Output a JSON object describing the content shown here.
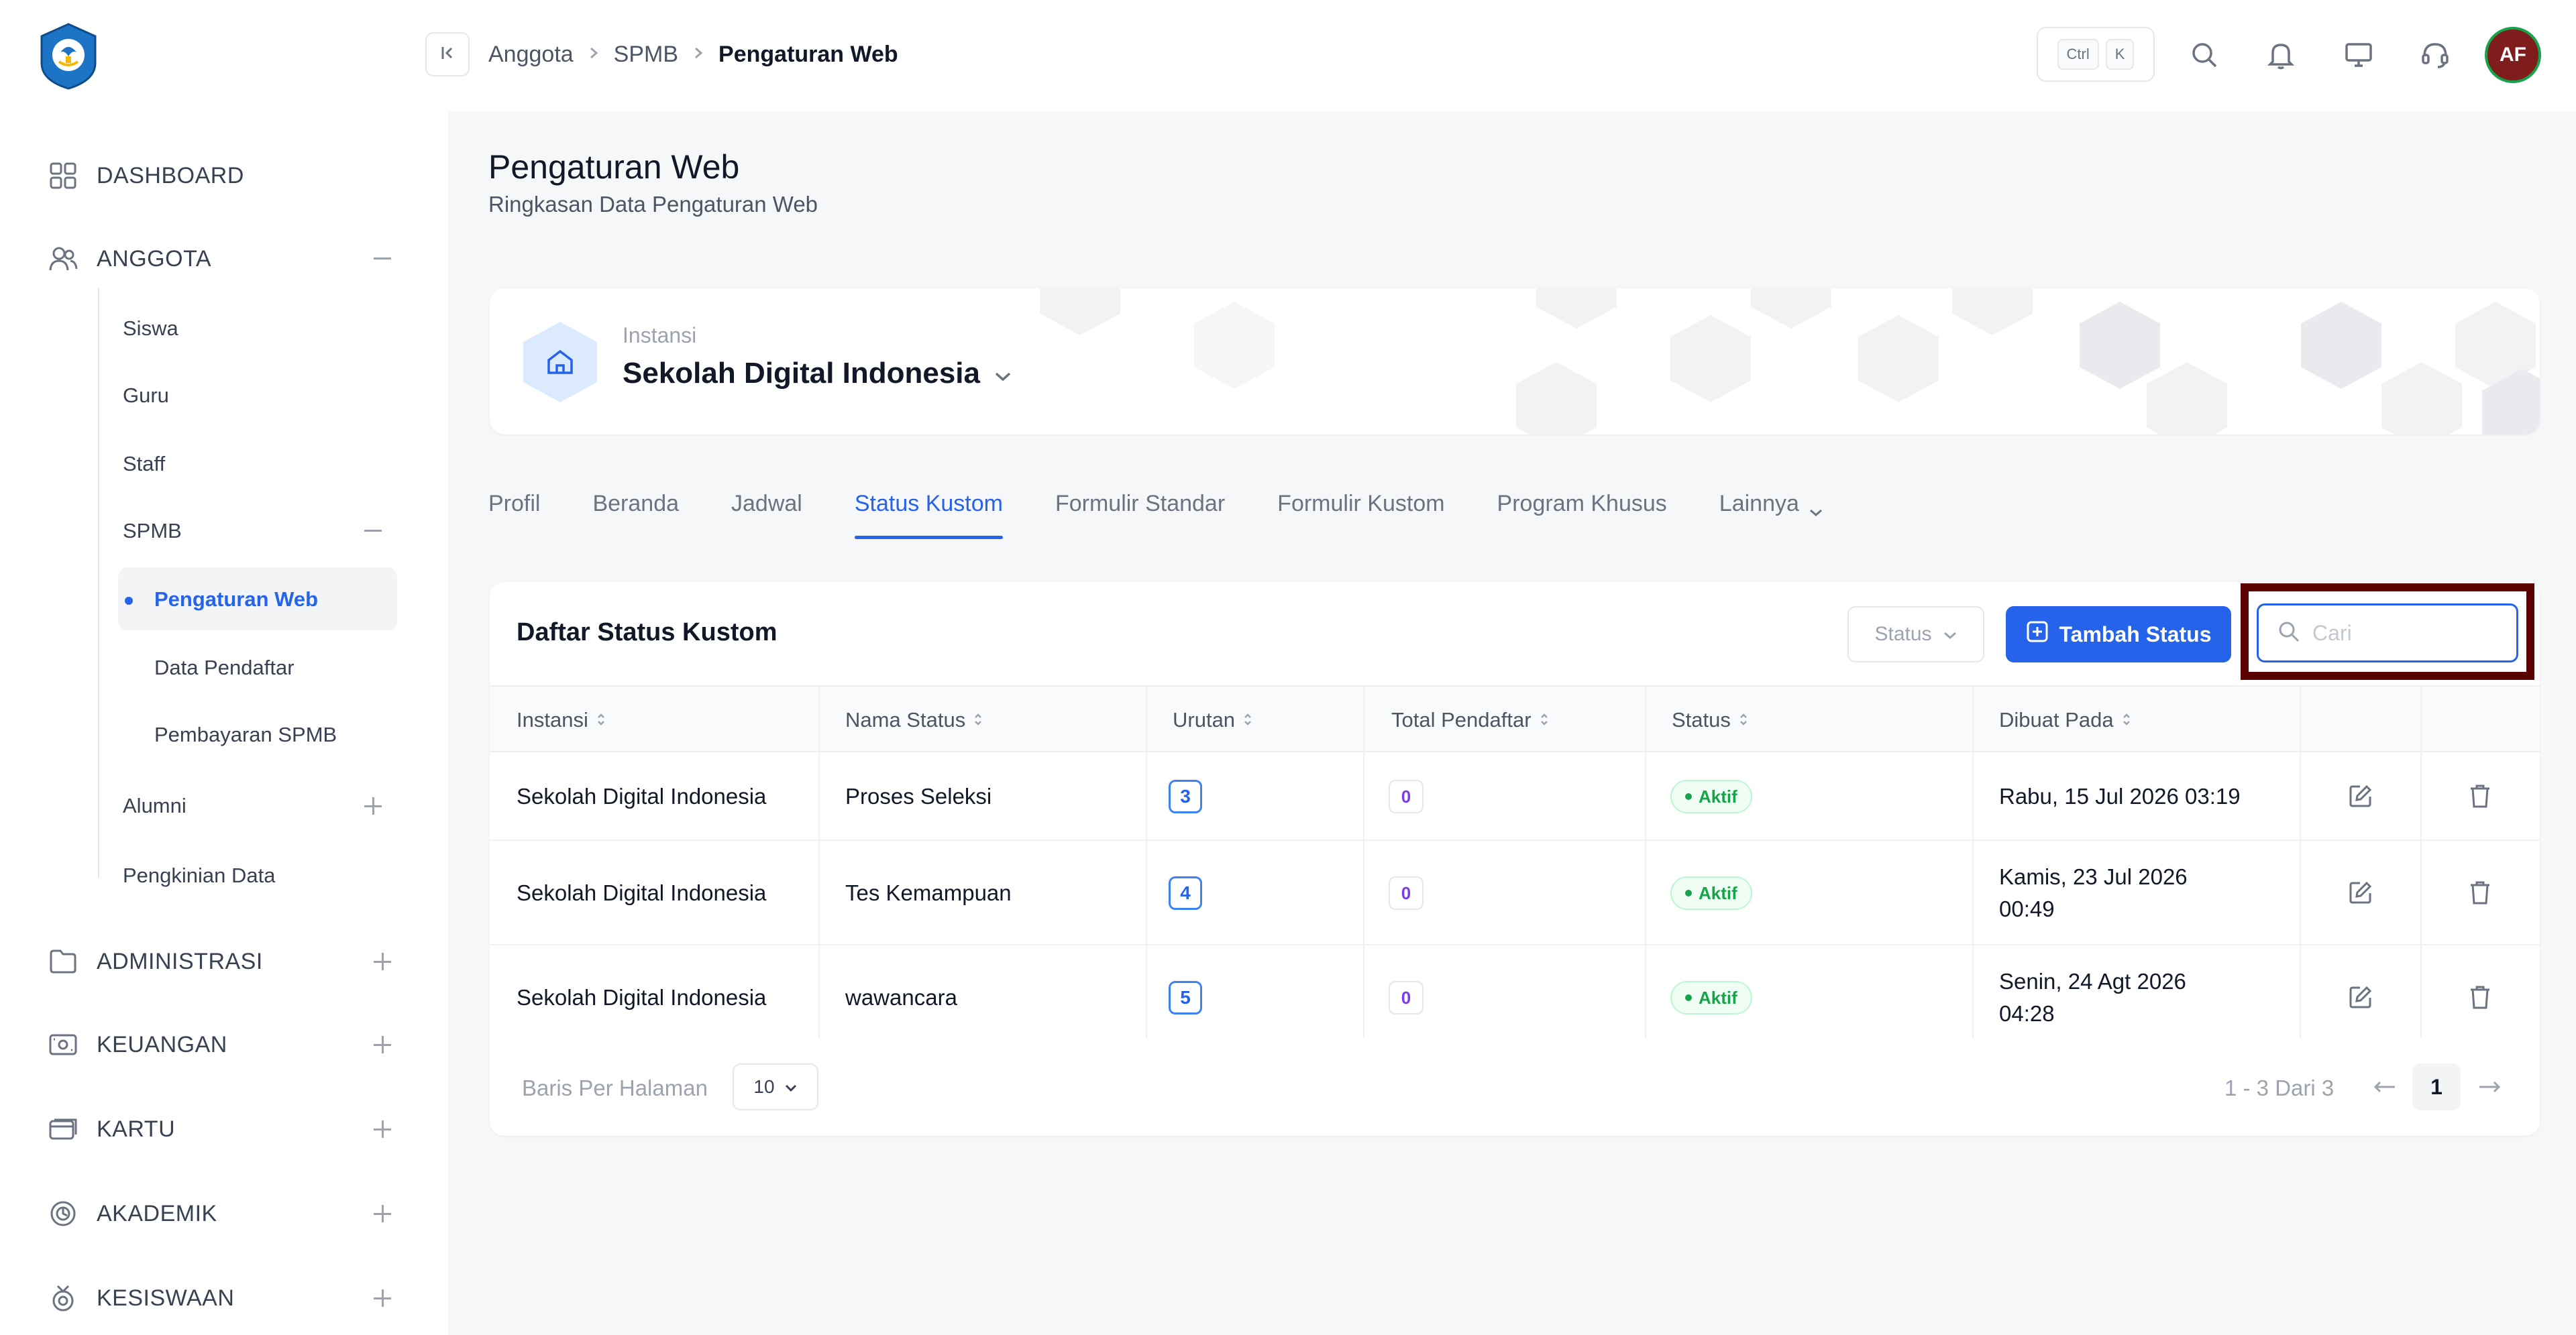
{
  "sidebar": {
    "logo": "tut-wuri-handayani-logo",
    "items": [
      {
        "label": "DASHBOARD",
        "icon": "grid-icon"
      },
      {
        "label": "ANGGOTA",
        "icon": "users-icon",
        "toggle": "minus"
      },
      {
        "label": "ADMINISTRASI",
        "icon": "folder-icon",
        "toggle": "plus"
      },
      {
        "label": "KEUANGAN",
        "icon": "cash-icon",
        "toggle": "plus"
      },
      {
        "label": "KARTU",
        "icon": "card-icon",
        "toggle": "plus"
      },
      {
        "label": "AKADEMIK",
        "icon": "badge-icon",
        "toggle": "plus"
      },
      {
        "label": "KESISWAAN",
        "icon": "award-icon",
        "toggle": "plus"
      }
    ],
    "anggota_sub": [
      "Siswa",
      "Guru",
      "Staff",
      "SPMB",
      "Alumni",
      "Pengkinian Data"
    ],
    "spmb_sub": [
      "Pengaturan Web",
      "Data Pendaftar",
      "Pembayaran SPMB"
    ]
  },
  "topbar": {
    "breadcrumb": [
      "Anggota",
      "SPMB",
      "Pengaturan Web"
    ],
    "kbd_ctrl": "Ctrl",
    "kbd_k": "K",
    "avatar_initials": "AF"
  },
  "page": {
    "title": "Pengaturan Web",
    "subtitle": "Ringkasan Data Pengaturan Web"
  },
  "instansi": {
    "label": "Instansi",
    "name": "Sekolah Digital Indonesia"
  },
  "tabs": [
    {
      "label": "Profil",
      "active": false
    },
    {
      "label": "Beranda",
      "active": false
    },
    {
      "label": "Jadwal",
      "active": false
    },
    {
      "label": "Status Kustom",
      "active": true
    },
    {
      "label": "Formulir Standar",
      "active": false
    },
    {
      "label": "Formulir Kustom",
      "active": false
    },
    {
      "label": "Program Khusus",
      "active": false
    },
    {
      "label": "Lainnya",
      "active": false
    }
  ],
  "table": {
    "title": "Daftar Status Kustom",
    "status_filter": "Status",
    "add_button": "Tambah Status",
    "search_placeholder": "Cari",
    "columns": [
      "Instansi",
      "Nama Status",
      "Urutan",
      "Total Pendaftar",
      "Status",
      "Dibuat Pada"
    ],
    "rows": [
      {
        "instansi": "Sekolah Digital Indonesia",
        "nama": "Proses Seleksi",
        "urutan": "3",
        "total": "0",
        "status": "Aktif",
        "dibuat1": "Rabu, 15 Jul 2026 03:19",
        "dibuat2": ""
      },
      {
        "instansi": "Sekolah Digital Indonesia",
        "nama": "Tes Kemampuan",
        "urutan": "4",
        "total": "0",
        "status": "Aktif",
        "dibuat1": "Kamis, 23 Jul 2026",
        "dibuat2": "00:49"
      },
      {
        "instansi": "Sekolah Digital Indonesia",
        "nama": "wawancara",
        "urutan": "5",
        "total": "0",
        "status": "Aktif",
        "dibuat1": "Senin, 24 Agt 2026",
        "dibuat2": "04:28"
      }
    ],
    "footer": {
      "rows_label": "Baris Per Halaman",
      "rows_value": "10",
      "page_info": "1 - 3 Dari 3",
      "current_page": "1"
    }
  },
  "colors": {
    "primary": "#2563eb",
    "highlight_border": "#5b0000",
    "success": "#16a34a"
  }
}
